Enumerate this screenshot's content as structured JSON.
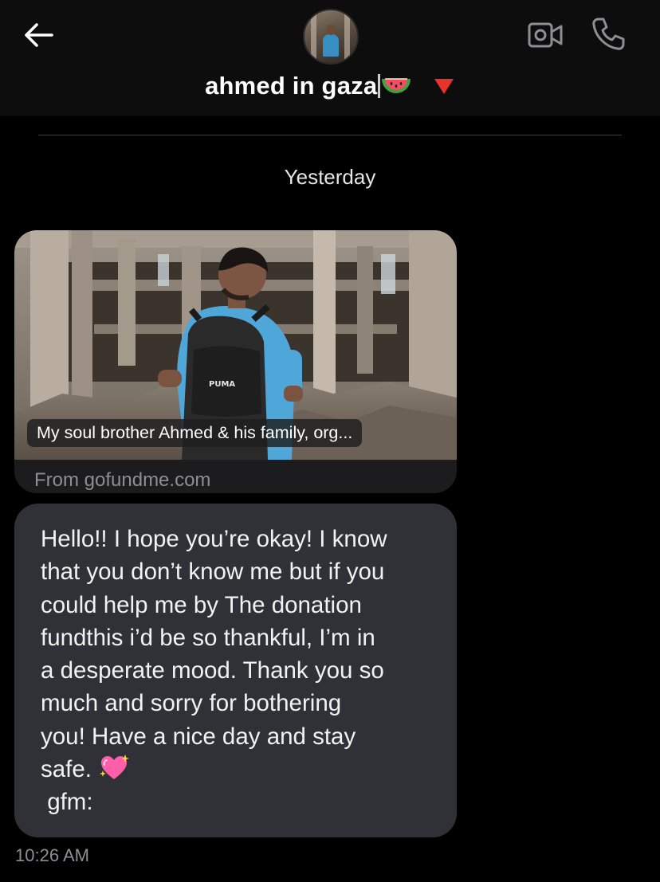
{
  "header": {
    "title": "ahmed in gaza",
    "back_icon": "arrow-left-icon",
    "video_icon": "video-camera-icon",
    "phone_icon": "phone-icon",
    "title_emojis": [
      "watermelon-icon",
      "red-triangle-down-icon"
    ]
  },
  "conversation": {
    "date_label": "Yesterday",
    "link_card": {
      "caption": "My soul brother Ahmed & his family, org...",
      "source": "From gofundme.com"
    },
    "message": {
      "lines": [
        "Hello!! I hope you’re okay! I know",
        "that you don’t know me but if you",
        "could help me by The donation",
        "fundthis i’d be so thankful, I’m in",
        "a desperate mood. Thank you so",
        "much and sorry for bothering",
        "you! Have a nice day and stay",
        "safe. ",
        " gfm:"
      ],
      "emoji": "sparkling-heart-icon"
    },
    "timestamp": "10:26 AM"
  },
  "colors": {
    "background": "#000000",
    "header": "#0d0d0d",
    "bubble": "#303136",
    "card": "#1c1c1e",
    "secondary_text": "#8e8e93"
  }
}
